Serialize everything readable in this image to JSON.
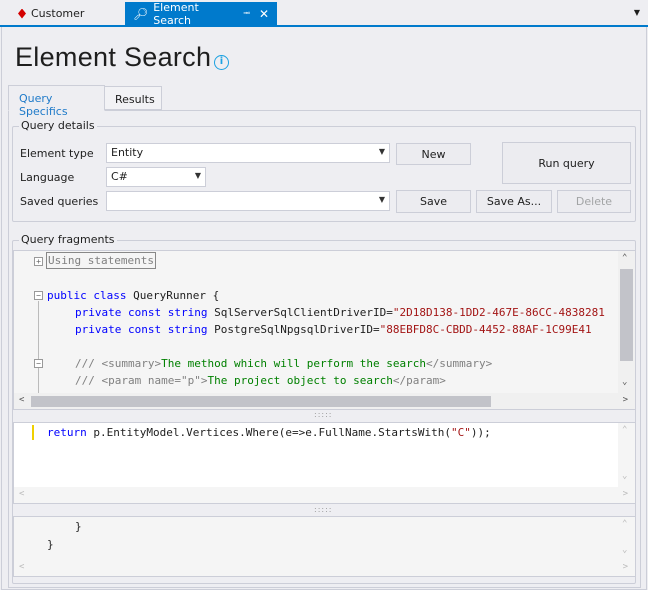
{
  "doc_tabs": [
    {
      "label": "Customer",
      "icon": "red-diamond-icon"
    },
    {
      "label": "Element Search",
      "icon": "magnifier-icon",
      "active": true
    }
  ],
  "title": "Element Search",
  "tabs": [
    {
      "label": "Query Specifics",
      "active": true
    },
    {
      "label": "Results"
    }
  ],
  "query_details": {
    "label": "Query details",
    "element_type_label": "Element type",
    "element_type_value": "Entity",
    "language_label": "Language",
    "language_value": "C#",
    "saved_queries_label": "Saved queries",
    "saved_queries_value": "",
    "new_label": "New",
    "run_label": "Run query",
    "save_label": "Save",
    "save_as_label": "Save As...",
    "delete_label": "Delete"
  },
  "fragments": {
    "label": "Query fragments",
    "editor1": {
      "using": "Using statements",
      "l_public": "public class",
      "l_class": " QueryRunner {",
      "l_priv": "private const string",
      "l_id1": " SqlServerSqlClientDriverID=",
      "l_v1": "\"2D18D138-1DD2-467E-86CC-4838281",
      "l_id2": " PostgreSqlNpgsqlDriverID=",
      "l_v2": "\"88EBFD8C-CBDD-4452-88AF-1C99E41",
      "c1a": "/// <summary>",
      "c1b": "The method which will perform the search",
      "c1c": "</summary>",
      "c2a": "/// <param name=\"p\">",
      "c2b": "The project object to search",
      "c2c": "</param>"
    },
    "editor2": {
      "kw": "return",
      "code": " p.EntityModel.Vertices.Where(e=>e.FullName.StartsWith(",
      "str": "\"C\"",
      "end": "));"
    },
    "editor3": {
      "l1": "}",
      "l2": "}"
    }
  },
  "colors": {
    "accent": "#007acc",
    "keyword": "#0000ff",
    "string": "#a31515",
    "comment": "#008000"
  }
}
